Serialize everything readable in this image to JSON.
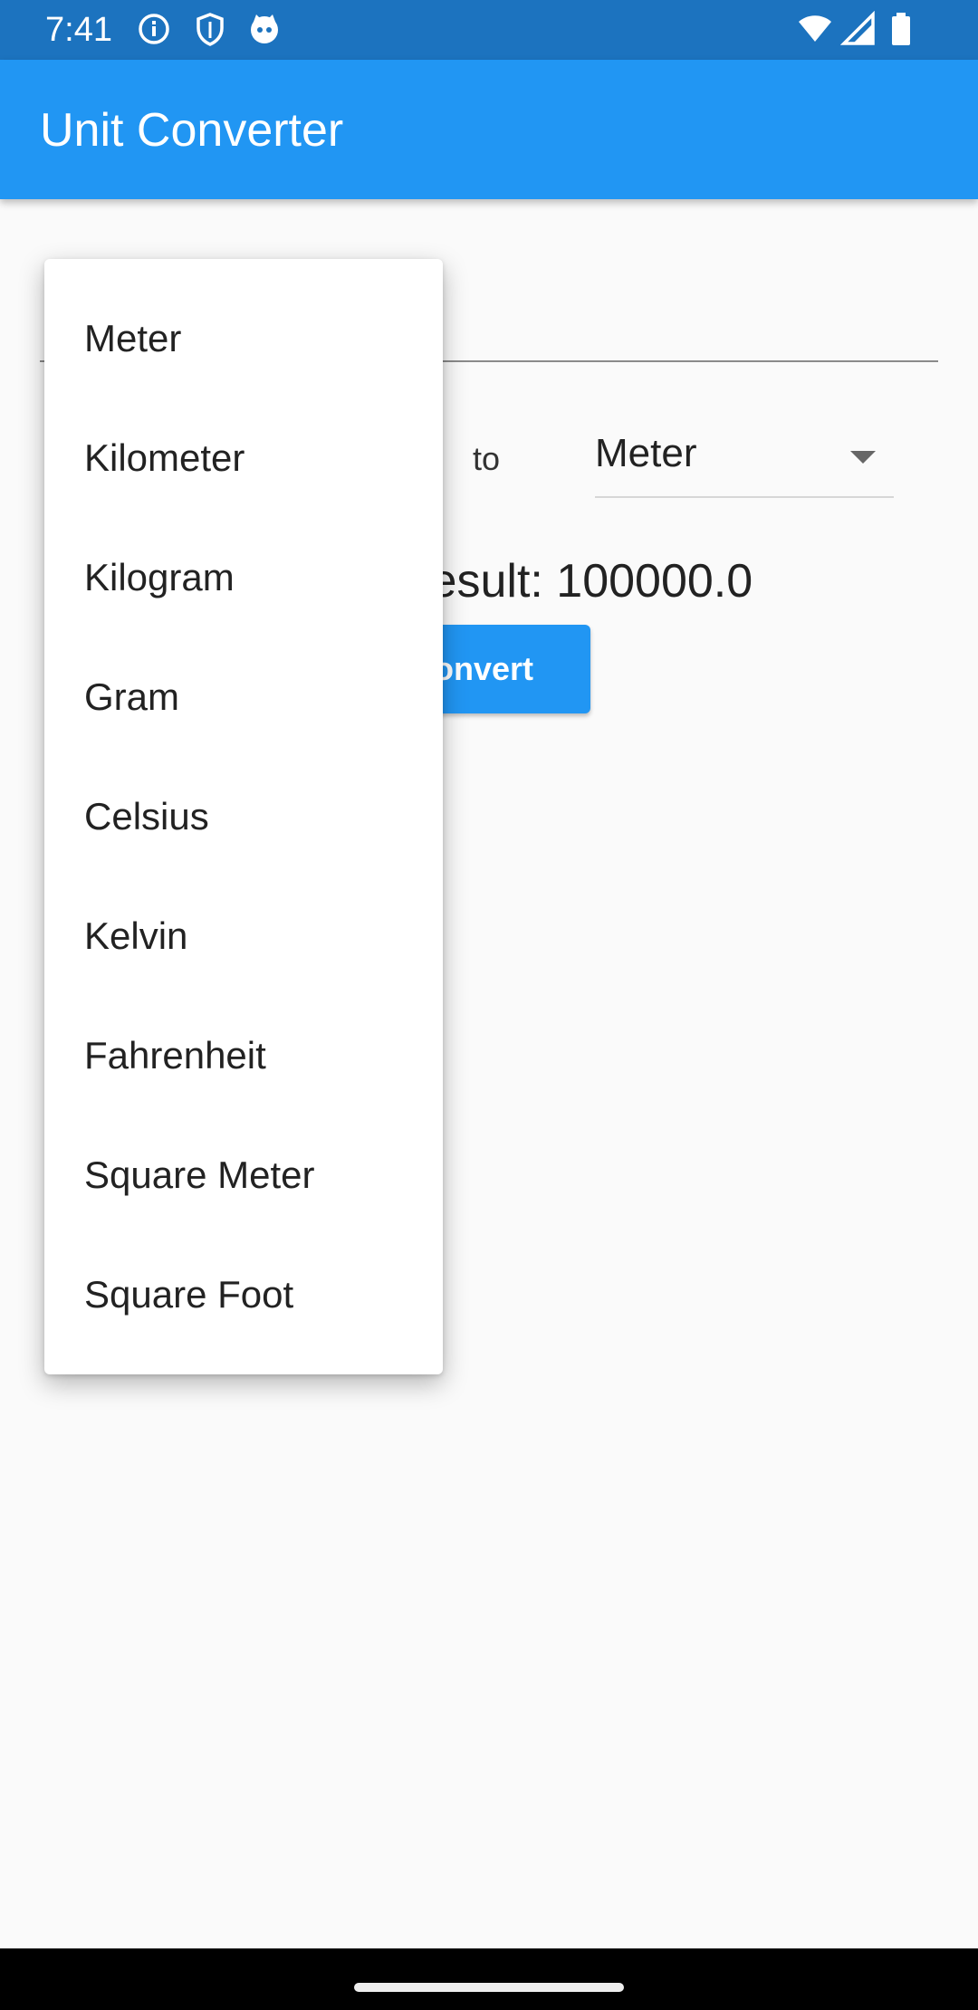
{
  "status_bar": {
    "time": "7:41",
    "left_icons": [
      "info-icon",
      "shield-icon",
      "cat-icon"
    ],
    "right_icons": [
      "wifi-icon",
      "signal-icon",
      "battery-icon"
    ]
  },
  "app_bar": {
    "title": "Unit Converter",
    "color": "#2196f3"
  },
  "form": {
    "input_value": "",
    "to_label": "to",
    "to_unit": "Meter",
    "result_text": "Result: 100000.0",
    "convert_label": "Convert"
  },
  "menu": {
    "items": [
      "Meter",
      "Kilometer",
      "Kilogram",
      "Gram",
      "Celsius",
      "Kelvin",
      "Fahrenheit",
      "Square Meter",
      "Square Foot"
    ]
  }
}
